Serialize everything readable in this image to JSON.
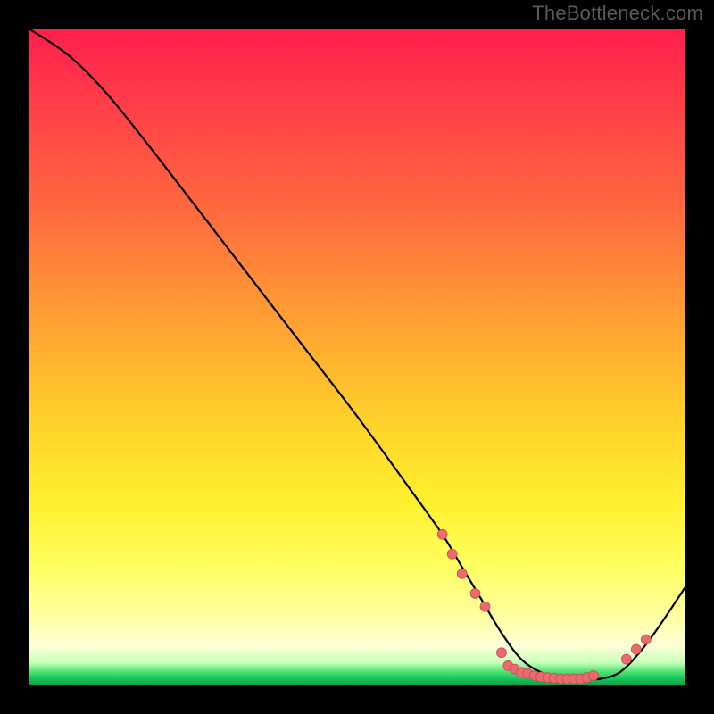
{
  "watermark": "TheBottleneck.com",
  "colors": {
    "background": "#000000",
    "curve": "#000000",
    "marker_fill": "#e96a6f",
    "marker_stroke": "#cc4d52"
  },
  "chart_data": {
    "type": "line",
    "title": "",
    "xlabel": "",
    "ylabel": "",
    "xlim": [
      0,
      100
    ],
    "ylim": [
      0,
      100
    ],
    "series": [
      {
        "name": "bottleneck-curve",
        "x": [
          0,
          6,
          12,
          20,
          30,
          40,
          50,
          58,
          63,
          66,
          69,
          72,
          75,
          78,
          81,
          84,
          87,
          90,
          93,
          96,
          100
        ],
        "y": [
          100,
          96,
          90,
          80,
          67,
          54,
          41,
          30,
          23,
          18,
          13,
          8,
          4,
          2,
          1,
          1,
          1,
          2,
          5,
          9,
          15
        ]
      }
    ],
    "markers": [
      {
        "x": 63,
        "y": 23
      },
      {
        "x": 64.5,
        "y": 20
      },
      {
        "x": 66,
        "y": 17
      },
      {
        "x": 68,
        "y": 14
      },
      {
        "x": 69.5,
        "y": 12
      },
      {
        "x": 72,
        "y": 5
      },
      {
        "x": 73,
        "y": 3
      },
      {
        "x": 74,
        "y": 2.5
      },
      {
        "x": 75,
        "y": 2
      },
      {
        "x": 76,
        "y": 1.8
      },
      {
        "x": 77,
        "y": 1.5
      },
      {
        "x": 78,
        "y": 1.3
      },
      {
        "x": 79,
        "y": 1.2
      },
      {
        "x": 80,
        "y": 1.1
      },
      {
        "x": 81,
        "y": 1
      },
      {
        "x": 82,
        "y": 1
      },
      {
        "x": 83,
        "y": 1
      },
      {
        "x": 84,
        "y": 1
      },
      {
        "x": 85,
        "y": 1.2
      },
      {
        "x": 86,
        "y": 1.5
      },
      {
        "x": 91,
        "y": 4
      },
      {
        "x": 92.5,
        "y": 5.5
      },
      {
        "x": 94,
        "y": 7
      }
    ]
  }
}
